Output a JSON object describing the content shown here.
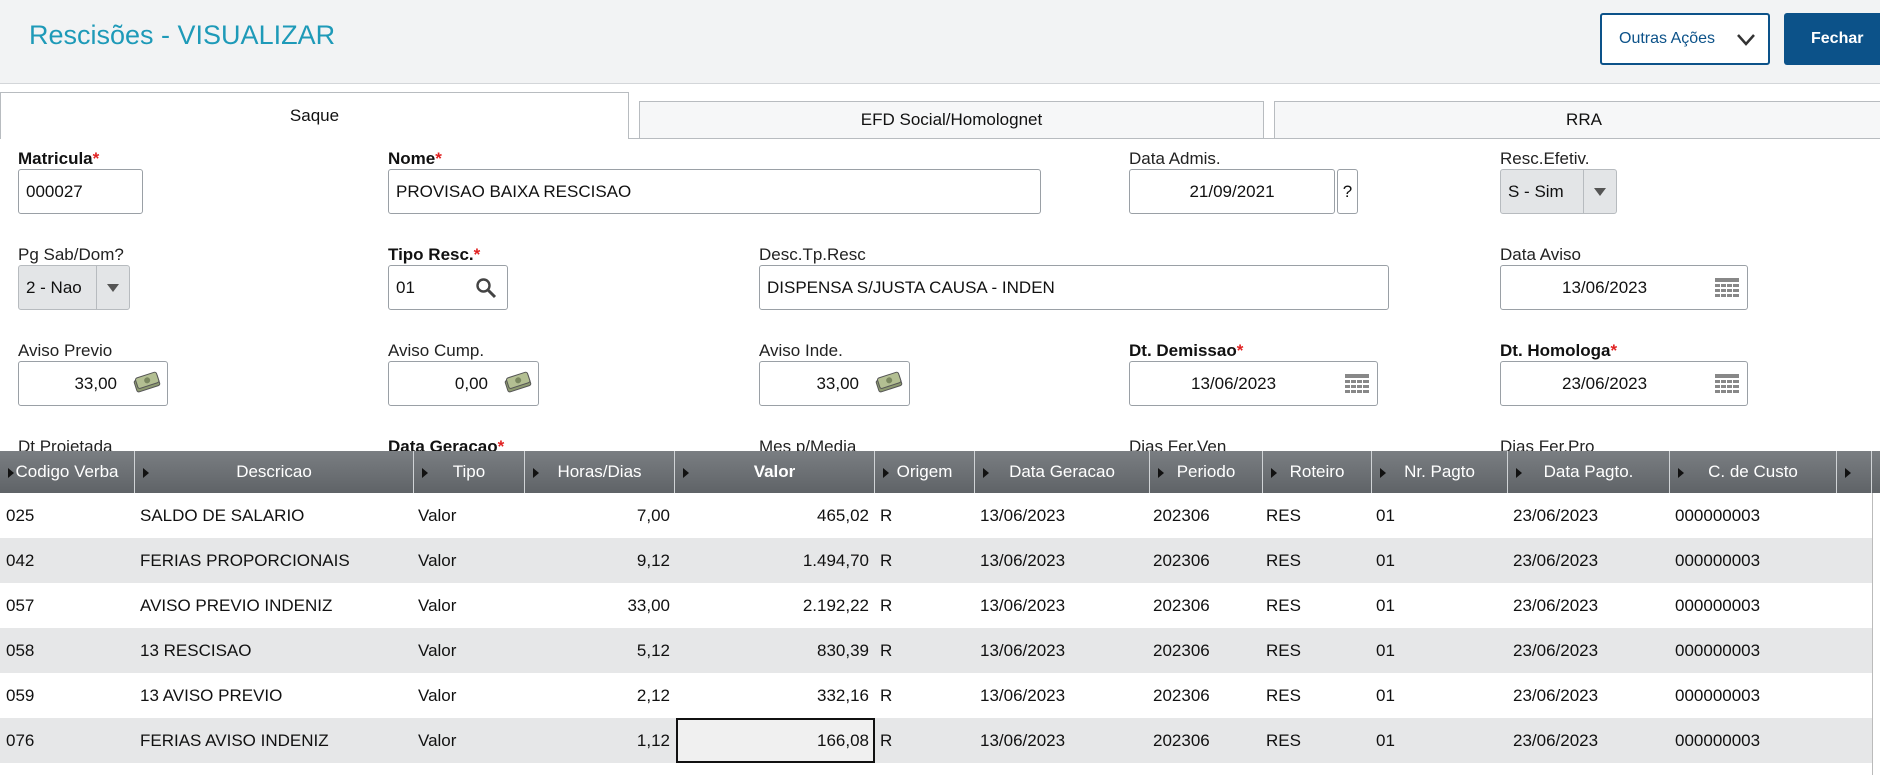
{
  "header": {
    "title": "Rescisões - VISUALIZAR",
    "actions_label": "Outras Ações",
    "close_label": "Fechar"
  },
  "tabs": [
    {
      "label": "Saque",
      "active": true
    },
    {
      "label": "EFD Social/Homolognet",
      "active": false
    },
    {
      "label": "RRA",
      "active": false
    }
  ],
  "form": {
    "matricula": {
      "label": "Matricula",
      "value": "000027"
    },
    "nome": {
      "label": "Nome",
      "value": "PROVISAO BAIXA RESCISAO"
    },
    "data_admis": {
      "label": "Data Admis.",
      "value": "21/09/2021",
      "help": "?"
    },
    "resc_efetiv": {
      "label": "Resc.Efetiv.",
      "value": "S - Sim"
    },
    "pg_sab_dom": {
      "label": "Pg Sab/Dom?",
      "value": "2 - Nao"
    },
    "tipo_resc": {
      "label": "Tipo Resc.",
      "value": "01"
    },
    "desc_tp_resc": {
      "label": "Desc.Tp.Resc",
      "value": "DISPENSA S/JUSTA CAUSA - INDEN"
    },
    "data_aviso": {
      "label": "Data Aviso",
      "value": "13/06/2023"
    },
    "aviso_previo": {
      "label": "Aviso Previo",
      "value": "33,00"
    },
    "aviso_cump": {
      "label": "Aviso Cump.",
      "value": "0,00"
    },
    "aviso_inde": {
      "label": "Aviso Inde.",
      "value": "33,00"
    },
    "dt_demissao": {
      "label": "Dt. Demissao",
      "value": "13/06/2023"
    },
    "dt_homologa": {
      "label": "Dt. Homologa",
      "value": "23/06/2023"
    },
    "dt_projetada": {
      "label": "Dt Projetada"
    },
    "data_geracao": {
      "label": "Data Geracao"
    },
    "mes_media": {
      "label": "Mes p/Media"
    },
    "dias_fer_ven": {
      "label": "Dias Fer.Ven"
    },
    "dias_fer_pro": {
      "label": "Dias Fer.Pro"
    },
    "required_mark": "*"
  },
  "grid": {
    "columns": [
      "Codigo Verba",
      "Descricao",
      "Tipo",
      "Horas/Dias",
      "Valor",
      "Origem",
      "Data Geracao",
      "Periodo",
      "Roteiro",
      "Nr. Pagto",
      "Data Pagto.",
      "C. de Custo"
    ],
    "rows": [
      [
        "025",
        "SALDO DE SALARIO",
        "Valor",
        "7,00",
        "465,02",
        "R",
        "13/06/2023",
        "202306",
        "RES",
        "01",
        "23/06/2023",
        "000000003"
      ],
      [
        "042",
        "FERIAS PROPORCIONAIS",
        "Valor",
        "9,12",
        "1.494,70",
        "R",
        "13/06/2023",
        "202306",
        "RES",
        "01",
        "23/06/2023",
        "000000003"
      ],
      [
        "057",
        "AVISO PREVIO INDENIZ",
        "Valor",
        "33,00",
        "2.192,22",
        "R",
        "13/06/2023",
        "202306",
        "RES",
        "01",
        "23/06/2023",
        "000000003"
      ],
      [
        "058",
        "13 RESCISAO",
        "Valor",
        "5,12",
        "830,39",
        "R",
        "13/06/2023",
        "202306",
        "RES",
        "01",
        "23/06/2023",
        "000000003"
      ],
      [
        "059",
        "13 AVISO PREVIO",
        "Valor",
        "2,12",
        "332,16",
        "R",
        "13/06/2023",
        "202306",
        "RES",
        "01",
        "23/06/2023",
        "000000003"
      ],
      [
        "076",
        "FERIAS AVISO INDENIZ",
        "Valor",
        "1,12",
        "166,08",
        "R",
        "13/06/2023",
        "202306",
        "RES",
        "01",
        "23/06/2023",
        "000000003"
      ]
    ]
  }
}
